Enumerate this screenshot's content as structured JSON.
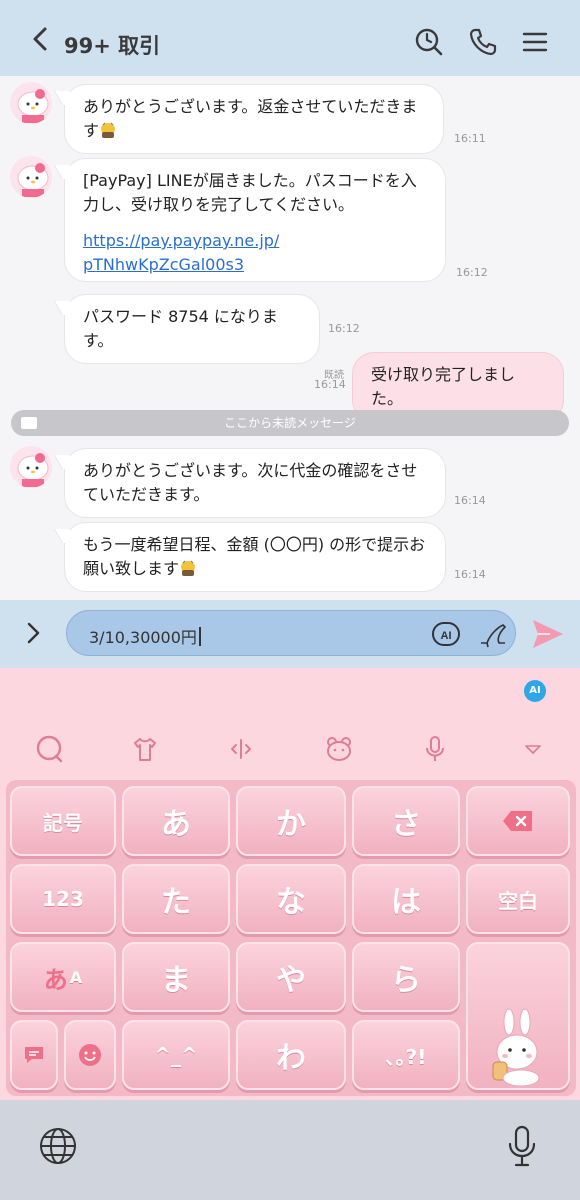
{
  "header": {
    "title": "99+ 取引",
    "icons": [
      "back-chevron-icon",
      "search-history-icon",
      "phone-icon",
      "menu-icon"
    ]
  },
  "messages": [
    {
      "side": "in",
      "text": "ありがとうございます。返金させていただきます",
      "emoji": "bow-emoji",
      "time": "16:11"
    },
    {
      "side": "in",
      "text": "[PayPay] LINEが届きました。パスコードを入力し、受け取りを完了してください。",
      "link_line1": "https://pay.paypay.ne.jp/",
      "link_line2": "pTNhwKpZcGal00s3",
      "time": "16:12"
    },
    {
      "side": "in",
      "text": "パスワード 8754 になります。",
      "time": "16:12"
    },
    {
      "side": "out",
      "text": "受け取り完了しました。",
      "read": "既読",
      "time": "16:14"
    },
    {
      "side": "in",
      "text": "ありがとうございます。次に代金の確認をさせていただきます。",
      "time": "16:14"
    },
    {
      "side": "in",
      "text": "もう一度希望日程、金額 (〇〇円) の形で提示お願い致します",
      "emoji": "bow-emoji",
      "time": "16:14"
    }
  ],
  "unread_divider": "ここから未読メッセージ",
  "input": {
    "value": "3/10,30000円"
  },
  "keyboard": {
    "ai_badge": "AI",
    "rows": [
      [
        "記号",
        "あ",
        "か",
        "さ",
        "⌫"
      ],
      [
        "123",
        "た",
        "な",
        "は",
        "空白"
      ],
      [
        "あA",
        "ま",
        "や",
        "ら",
        ""
      ],
      [
        "",
        "",
        "^_^",
        "わ",
        "､｡?!"
      ]
    ],
    "key_kigo": "記号",
    "key_a": "あ",
    "key_ka": "か",
    "key_sa": "さ",
    "key_123": "123",
    "key_ta": "た",
    "key_na": "な",
    "key_ha": "は",
    "key_space": "空白",
    "key_mode_a": "あ",
    "key_mode_A": "A",
    "key_ma": "ま",
    "key_ya": "や",
    "key_ra": "ら",
    "key_face": "^_^",
    "key_wa": "わ",
    "key_punct": "､｡?!"
  },
  "colors": {
    "header_bg": "#cfe0ef",
    "keyboard_bg": "#fdd7df",
    "key_pink": "#f1b1c1",
    "send_pink": "#f39ab0",
    "link_blue": "#2a6fd0"
  }
}
